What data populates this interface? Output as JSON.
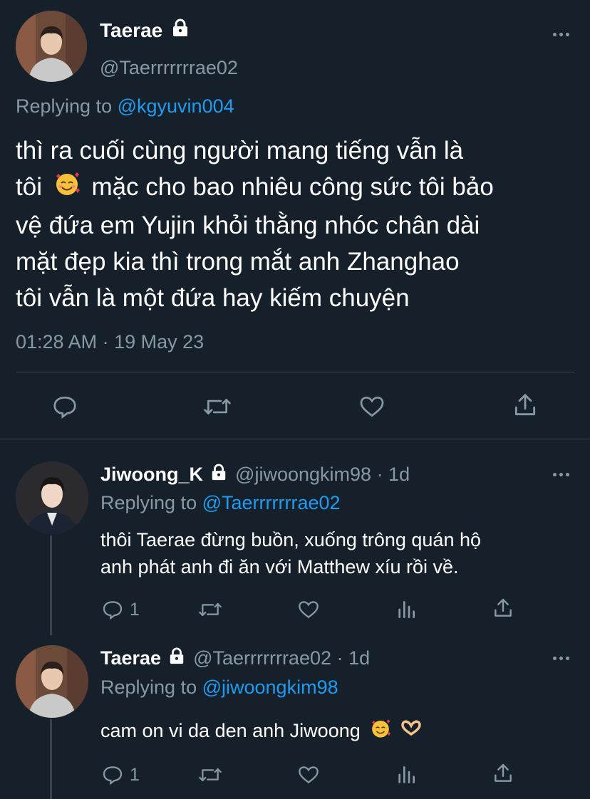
{
  "main_tweet": {
    "display_name": "Taerae",
    "handle": "@Taerrrrrrrae02",
    "replying_prefix": "Replying to",
    "replying_to": "@kgyuvin004",
    "text_line1": "thì ra cuối cùng người mang tiếng vẫn là",
    "text_line2_a": "tôi",
    "text_line2_b": "mặc cho bao nhiêu công sức tôi bảo",
    "text_line3": "vệ đứa em Yujin khỏi thằng nhóc chân dài",
    "text_line4": "mặt đẹp kia thì trong mắt anh Zhanghao",
    "text_line5": "tôi vẫn là một đứa hay kiếm chuyện",
    "timestamp": "01:28 AM · 19 May 23",
    "avatar_icon": "avatar-photo",
    "verified_icon": "lock-icon"
  },
  "reply1": {
    "display_name": "Jiwoong_K",
    "handle": "@jiwoongkim98",
    "time": "· 1d",
    "replying_prefix": "Replying to",
    "replying_to": "@Taerrrrrrrae02",
    "text_line1": "thôi Taerae đừng buồn, xuống trông quán hộ",
    "text_line2": "anh phát anh đi ăn với Matthew xíu rồi về.",
    "reply_count": "1"
  },
  "reply2": {
    "display_name": "Taerae",
    "handle": "@Taerrrrrrrae02",
    "time": "· 1d",
    "replying_prefix": "Replying to",
    "replying_to": "@jiwoongkim98",
    "text": "cam on vi da den anh Jiwoong",
    "reply_count": "1"
  },
  "colors": {
    "background": "#15202b",
    "secondary_text": "#8899a6",
    "link": "#1d9bf0",
    "divider": "#38444d"
  }
}
